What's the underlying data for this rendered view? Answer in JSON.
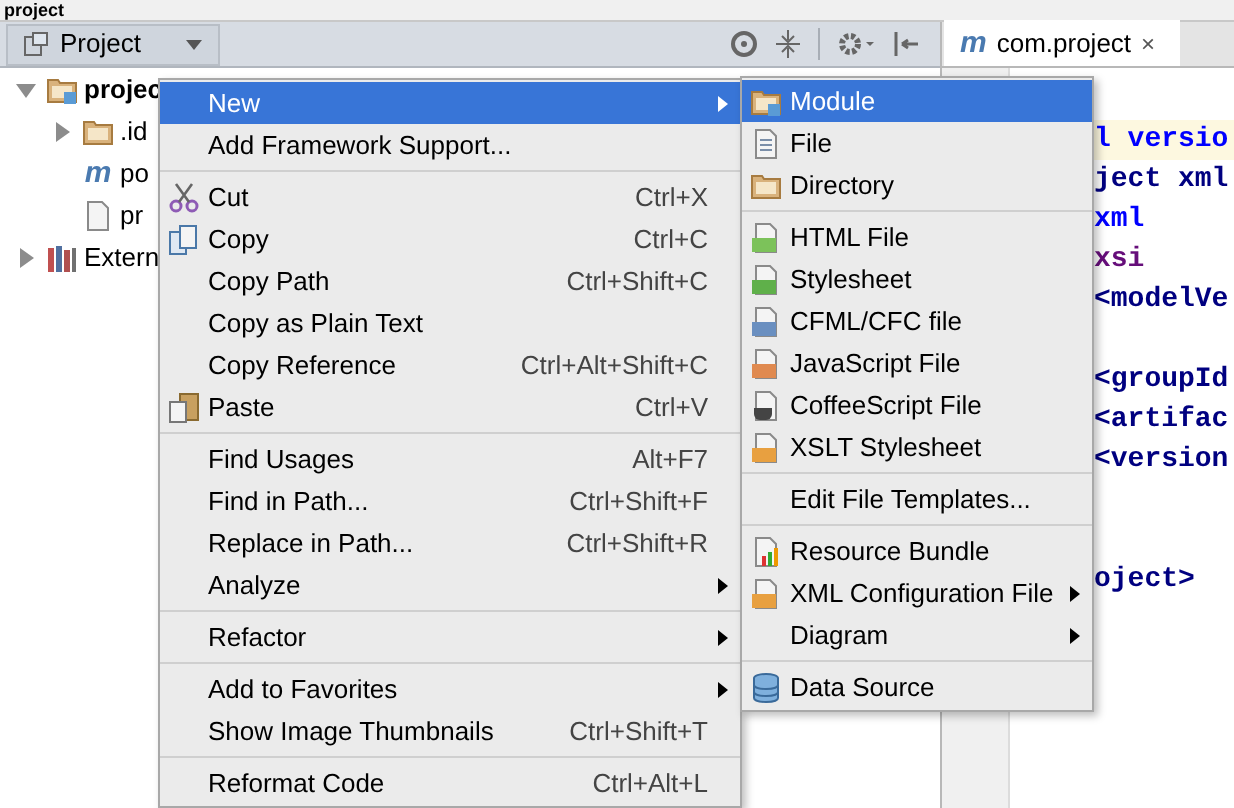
{
  "breadcrumb": "project",
  "project_panel": {
    "view_selector": "Project"
  },
  "editor_tab": {
    "icon_text": "m",
    "title": "com.project",
    "close": "×",
    "selected": true
  },
  "tree": [
    {
      "label": "projec",
      "kind": "module",
      "expanded": true,
      "children": [
        {
          "label": ".id",
          "kind": "folder",
          "expanded": false
        },
        {
          "label": "po",
          "kind": "maven",
          "icon_text": "m"
        },
        {
          "label": "pr",
          "kind": "file"
        }
      ]
    },
    {
      "label": "Extern",
      "kind": "library",
      "expanded": false
    }
  ],
  "code_lines": [
    {
      "kind": "declaration",
      "text": "l versio",
      "current": true
    },
    {
      "kind": "tag",
      "text": "ject xml",
      "current": false
    },
    {
      "kind": "attribute",
      "text": "xml",
      "current": false
    },
    {
      "kind": "namespace",
      "text": "xsi",
      "current": false
    },
    {
      "kind": "tag",
      "text": "<modelVe",
      "current": false
    },
    {
      "kind": "blank"
    },
    {
      "kind": "tag",
      "text": "<groupId",
      "current": false
    },
    {
      "kind": "tag",
      "text": "<artifac",
      "current": false
    },
    {
      "kind": "tag",
      "text": "<version",
      "current": false
    },
    {
      "kind": "blank"
    },
    {
      "kind": "blank"
    },
    {
      "kind": "tag",
      "text": "oject>",
      "current": false
    }
  ],
  "context_menu": {
    "items": [
      {
        "kind": "item",
        "label": "New",
        "selected": true,
        "submenu": true
      },
      {
        "kind": "item",
        "label": "Add Framework Support...",
        "selected": false,
        "submenu": false
      },
      {
        "kind": "separator"
      },
      {
        "kind": "item",
        "label": "Cut",
        "shortcut": "Ctrl+X",
        "selected": false,
        "submenu": false
      },
      {
        "kind": "item",
        "label": "Copy",
        "shortcut": "Ctrl+C",
        "selected": false,
        "submenu": false
      },
      {
        "kind": "item",
        "label": "Copy Path",
        "shortcut": "Ctrl+Shift+C",
        "selected": false,
        "submenu": false
      },
      {
        "kind": "item",
        "label": "Copy as Plain Text",
        "selected": false,
        "submenu": false
      },
      {
        "kind": "item",
        "label": "Copy Reference",
        "shortcut": "Ctrl+Alt+Shift+C",
        "selected": false,
        "submenu": false
      },
      {
        "kind": "item",
        "label": "Paste",
        "shortcut": "Ctrl+V",
        "selected": false,
        "submenu": false
      },
      {
        "kind": "separator"
      },
      {
        "kind": "item",
        "label": "Find Usages",
        "shortcut": "Alt+F7",
        "selected": false,
        "submenu": false
      },
      {
        "kind": "item",
        "label": "Find in Path...",
        "shortcut": "Ctrl+Shift+F",
        "selected": false,
        "submenu": false
      },
      {
        "kind": "item",
        "label": "Replace in Path...",
        "shortcut": "Ctrl+Shift+R",
        "selected": false,
        "submenu": false
      },
      {
        "kind": "item",
        "label": "Analyze",
        "selected": false,
        "submenu": true
      },
      {
        "kind": "separator"
      },
      {
        "kind": "item",
        "label": "Refactor",
        "selected": false,
        "submenu": true
      },
      {
        "kind": "separator"
      },
      {
        "kind": "item",
        "label": "Add to Favorites",
        "selected": false,
        "submenu": true
      },
      {
        "kind": "item",
        "label": "Show Image Thumbnails",
        "shortcut": "Ctrl+Shift+T",
        "selected": false,
        "submenu": false
      },
      {
        "kind": "separator"
      },
      {
        "kind": "item",
        "label": "Reformat Code",
        "shortcut": "Ctrl+Alt+L",
        "selected": false,
        "submenu": false
      }
    ]
  },
  "new_submenu": {
    "items": [
      {
        "kind": "item",
        "label": "Module",
        "selected": true,
        "submenu": false
      },
      {
        "kind": "item",
        "label": "File",
        "selected": false,
        "submenu": false
      },
      {
        "kind": "item",
        "label": "Directory",
        "selected": false,
        "submenu": false
      },
      {
        "kind": "separator"
      },
      {
        "kind": "item",
        "label": "HTML File",
        "selected": false,
        "submenu": false
      },
      {
        "kind": "item",
        "label": "Stylesheet",
        "selected": false,
        "submenu": false
      },
      {
        "kind": "item",
        "label": "CFML/CFC file",
        "selected": false,
        "submenu": false
      },
      {
        "kind": "item",
        "label": "JavaScript File",
        "selected": false,
        "submenu": false
      },
      {
        "kind": "item",
        "label": "CoffeeScript File",
        "selected": false,
        "submenu": false
      },
      {
        "kind": "item",
        "label": "XSLT Stylesheet",
        "selected": false,
        "submenu": false
      },
      {
        "kind": "separator"
      },
      {
        "kind": "item",
        "label": "Edit File Templates...",
        "selected": false,
        "submenu": false
      },
      {
        "kind": "separator"
      },
      {
        "kind": "item",
        "label": "Resource Bundle",
        "selected": false,
        "submenu": false
      },
      {
        "kind": "item",
        "label": "XML Configuration File",
        "selected": false,
        "submenu": true
      },
      {
        "kind": "item",
        "label": "Diagram",
        "selected": false,
        "submenu": true
      },
      {
        "kind": "separator"
      },
      {
        "kind": "item",
        "label": "Data Source",
        "selected": false,
        "submenu": false
      }
    ]
  }
}
